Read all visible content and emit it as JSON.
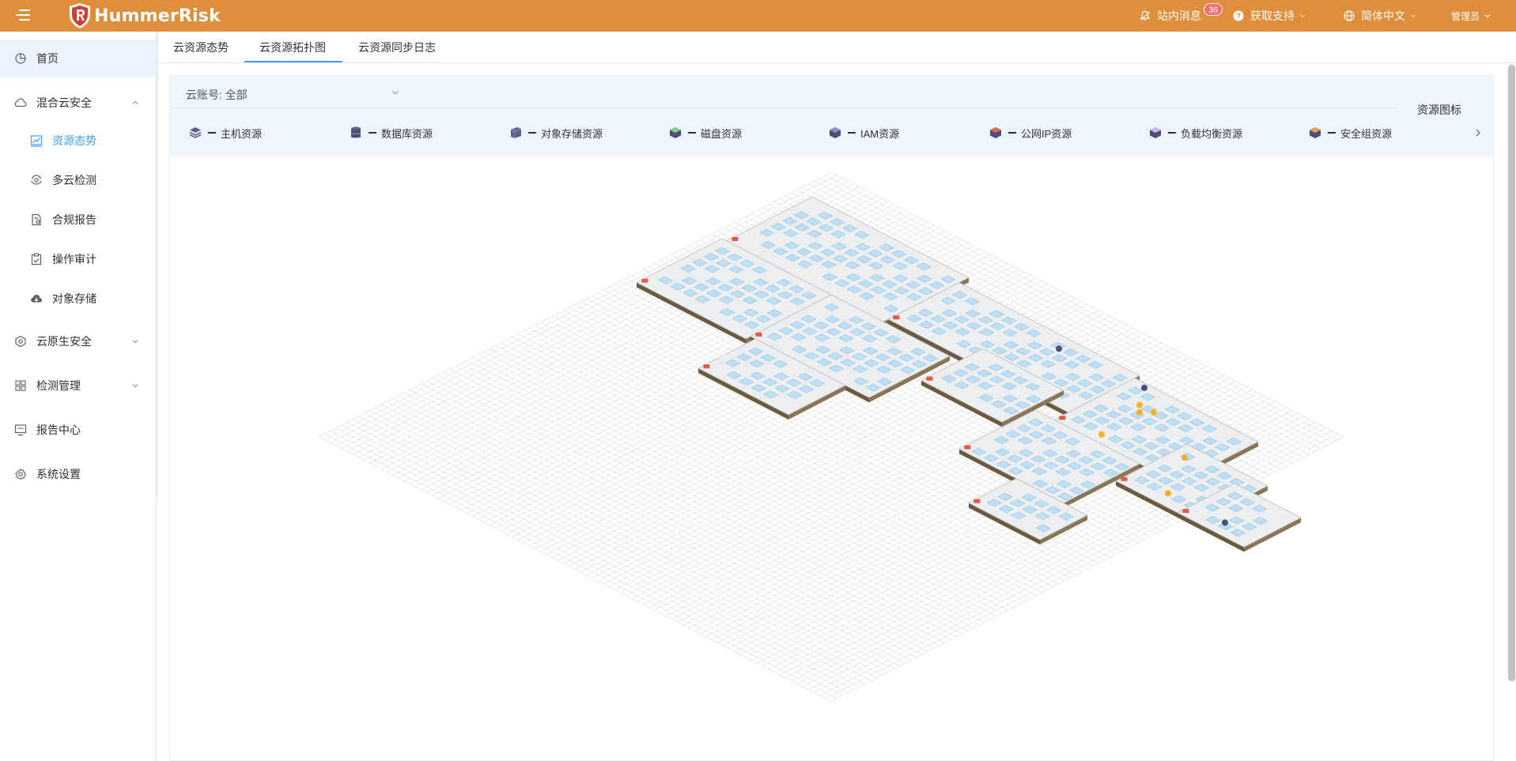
{
  "app": {
    "brand": "HummerRisk"
  },
  "header": {
    "notifications_label": "站内消息",
    "notifications_count": "36",
    "support_label": "获取支持",
    "language_label": "简体中文",
    "user_label": "管理员"
  },
  "sidebar": {
    "items": [
      {
        "label": "首页",
        "icon": "dashboard-icon"
      },
      {
        "label": "混合云安全",
        "icon": "cloud-icon",
        "expanded": true
      },
      {
        "label": "资源态势",
        "icon": "chart-icon",
        "selected": true
      },
      {
        "label": "多云检测",
        "icon": "scan-icon"
      },
      {
        "label": "合规报告",
        "icon": "report-icon"
      },
      {
        "label": "操作审计",
        "icon": "audit-icon"
      },
      {
        "label": "对象存储",
        "icon": "cloud-storage-icon"
      },
      {
        "label": "云原生安全",
        "icon": "cloud-native-icon"
      },
      {
        "label": "检测管理",
        "icon": "grid-icon"
      },
      {
        "label": "报告中心",
        "icon": "monitor-icon"
      },
      {
        "label": "系统设置",
        "icon": "gear-icon"
      }
    ]
  },
  "tabs": [
    {
      "label": "云资源态势"
    },
    {
      "label": "云资源拓扑图",
      "active": true
    },
    {
      "label": "云资源同步日志"
    }
  ],
  "filter": {
    "account_label": "云账号: 全部"
  },
  "legend": {
    "title": "资源图标",
    "items": [
      {
        "label": "主机资源",
        "icon": "server-stack-icon"
      },
      {
        "label": "数据库资源",
        "icon": "database-icon"
      },
      {
        "label": "对象存储资源",
        "icon": "object-storage-icon"
      },
      {
        "label": "磁盘资源",
        "icon": "disk-icon"
      },
      {
        "label": "IAM资源",
        "icon": "iam-icon"
      },
      {
        "label": "公网IP资源",
        "icon": "public-ip-icon"
      },
      {
        "label": "负载均衡资源",
        "icon": "load-balancer-icon"
      },
      {
        "label": "安全组资源",
        "icon": "security-group-icon"
      }
    ]
  },
  "colors": {
    "header_bg": "#df8f3b",
    "accent": "#409eff",
    "zone_fill": "#eceeef",
    "zone_border": "#6b5a3f",
    "resource_tile": "#bfe0f4",
    "highlight_resource": "#f6b12a"
  }
}
